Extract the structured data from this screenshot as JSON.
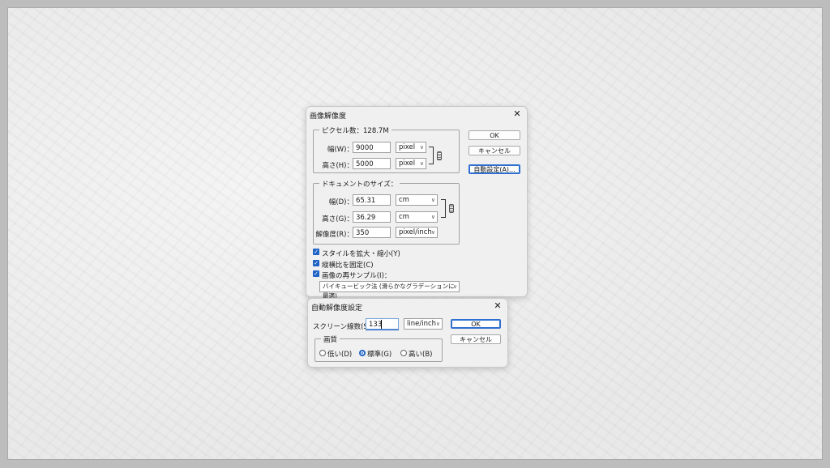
{
  "main": {
    "title": "画像解像度",
    "pixel_group": {
      "legend": "ピクセル数：128.7M",
      "width_label": "幅(W)：",
      "width_value": "9000",
      "width_unit": "pixel",
      "height_label": "高さ(H)：",
      "height_value": "5000",
      "height_unit": "pixel"
    },
    "doc_group": {
      "legend": "ドキュメントのサイズ：",
      "width_label": "幅(D)：",
      "width_value": "65.31",
      "width_unit": "cm",
      "height_label": "高さ(G)：",
      "height_value": "36.29",
      "height_unit": "cm",
      "res_label": "解像度(R)：",
      "res_value": "350",
      "res_unit": "pixel/inch"
    },
    "checkboxes": {
      "scale_styles": "スタイルを拡大・縮小(Y)",
      "constrain": "縦横比を固定(C)",
      "resample": "画像の再サンプル(I)："
    },
    "resample_method": "バイキュービック法 (滑らかなグラデーションに最適)",
    "buttons": {
      "ok": "OK",
      "cancel": "キャンセル",
      "auto": "自動設定(A)..."
    }
  },
  "auto": {
    "title": "自動解像度設定",
    "screen_label": "スクリーン線数(S)：",
    "screen_value": "133",
    "screen_unit": "line/inch",
    "quality_legend": "画質",
    "quality_options": [
      "低い(D)",
      "標準(G)",
      "高い(B)"
    ],
    "buttons": {
      "ok": "OK",
      "cancel": "キャンセル"
    }
  },
  "colors": {
    "accent": "#1f63c6",
    "dialog_bg": "#f0f0f0"
  }
}
